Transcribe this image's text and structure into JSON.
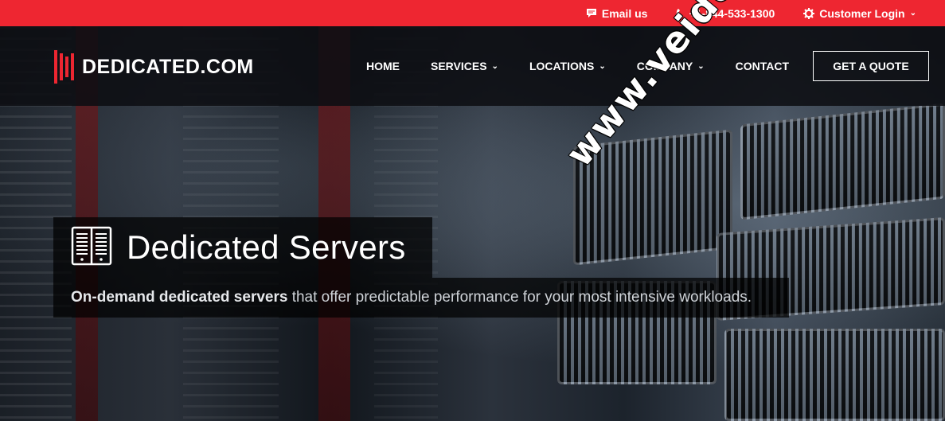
{
  "topbar": {
    "email_label": "Email us",
    "phone_label": "+1-844-533-1300",
    "login_label": "Customer Login"
  },
  "header": {
    "logo_text": "DEDICATED.COM",
    "nav": [
      {
        "label": "HOME",
        "has_dropdown": false
      },
      {
        "label": "SERVICES",
        "has_dropdown": true
      },
      {
        "label": "LOCATIONS",
        "has_dropdown": true
      },
      {
        "label": "COMPANY",
        "has_dropdown": true
      },
      {
        "label": "CONTACT",
        "has_dropdown": false
      }
    ],
    "quote_button": "GET A QUOTE"
  },
  "hero": {
    "title": "Dedicated Servers",
    "subtitle_bold": "On-demand dedicated servers",
    "subtitle_rest": " that offer predictable performance for your most intensive workloads."
  },
  "watermark": "www.veidc.com",
  "colors": {
    "brand_red": "#ee2631",
    "header_bg": "#0c0e12",
    "text_white": "#ffffff"
  },
  "icons": {
    "email": "chat-bubble-icon",
    "phone": "phone-icon",
    "login": "gear-icon",
    "hero": "server-icon"
  }
}
